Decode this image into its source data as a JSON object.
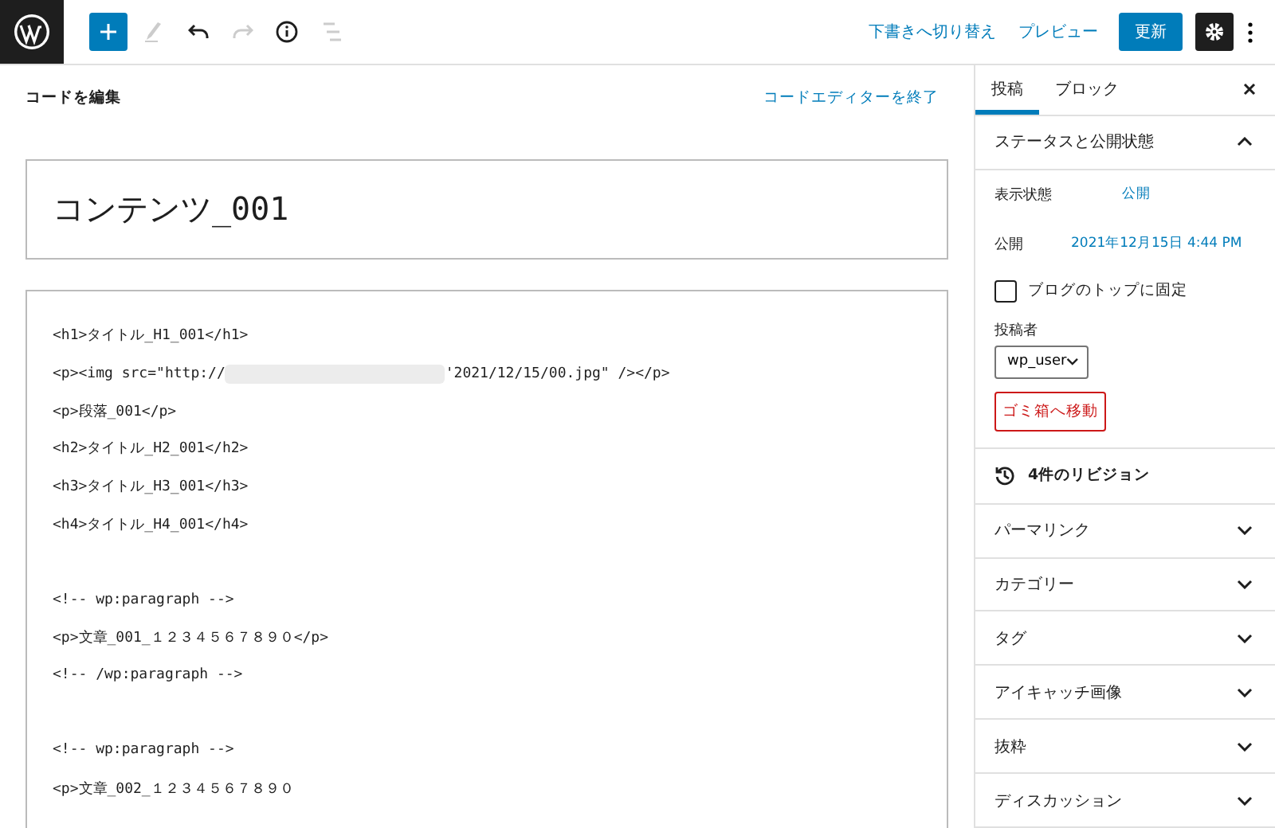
{
  "toolbar": {
    "tools": [
      {
        "kind": "add",
        "disabled": false
      },
      {
        "kind": "edit",
        "disabled": true
      },
      {
        "kind": "undo",
        "disabled": false
      },
      {
        "kind": "redo",
        "disabled": true
      },
      {
        "kind": "info",
        "disabled": false
      },
      {
        "kind": "list",
        "disabled": true
      }
    ],
    "switch_to_draft": "下書きへ切り替え",
    "preview": "プレビュー",
    "update": "更新",
    "settings_on": true
  },
  "editor": {
    "heading": "コードを編集",
    "exit": "コードエディターを終了",
    "title": "コンテンツ_001",
    "lines": [
      {
        "kind": "text",
        "text": "<h1>タイトル_H1_001</h1>"
      },
      {
        "kind": "redacted",
        "before": "<p><img src=\"http://",
        "after": "'2021/12/15/00.jpg\" /></p>"
      },
      {
        "kind": "text",
        "text": "<p>段落_001</p>"
      },
      {
        "kind": "text",
        "text": "<h2>タイトル_H2_001</h2>"
      },
      {
        "kind": "text",
        "text": "<h3>タイトル_H3_001</h3>"
      },
      {
        "kind": "text",
        "text": "<h4>タイトル_H4_001</h4>"
      },
      {
        "kind": "blank"
      },
      {
        "kind": "text",
        "text": "<!-- wp:paragraph -->"
      },
      {
        "kind": "text",
        "text": "<p>文章_001_１２３４５６７８９０</p>"
      },
      {
        "kind": "text",
        "text": "<!-- /wp:paragraph -->"
      },
      {
        "kind": "blank"
      },
      {
        "kind": "text",
        "text": "<!-- wp:paragraph -->"
      },
      {
        "kind": "text",
        "text": "<p>文章_002_１２３４５６７８９０"
      }
    ]
  },
  "sidebar": {
    "tabs": [
      {
        "label": "投稿",
        "selected": true
      },
      {
        "label": "ブロック",
        "selected": false
      }
    ],
    "status": {
      "title": "ステータスと公開状態",
      "expanded": true,
      "visibility_label": "表示状態",
      "visibility": "公開",
      "publish_label": "公開",
      "publish": "2021年12月15日 4:44 PM",
      "sticky": {
        "label": "ブログのトップに固定",
        "checked": false
      },
      "author_label": "投稿者",
      "author": "wp_user",
      "trash": "ゴミ箱へ移動"
    },
    "revisions": "4件のリビジョン",
    "panels": [
      {
        "title": "パーマリンク",
        "expanded": false
      },
      {
        "title": "カテゴリー",
        "expanded": false
      },
      {
        "title": "タグ",
        "expanded": false
      },
      {
        "title": "アイキャッチ画像",
        "expanded": false
      },
      {
        "title": "抜粋",
        "expanded": false
      },
      {
        "title": "ディスカッション",
        "expanded": false
      }
    ]
  }
}
